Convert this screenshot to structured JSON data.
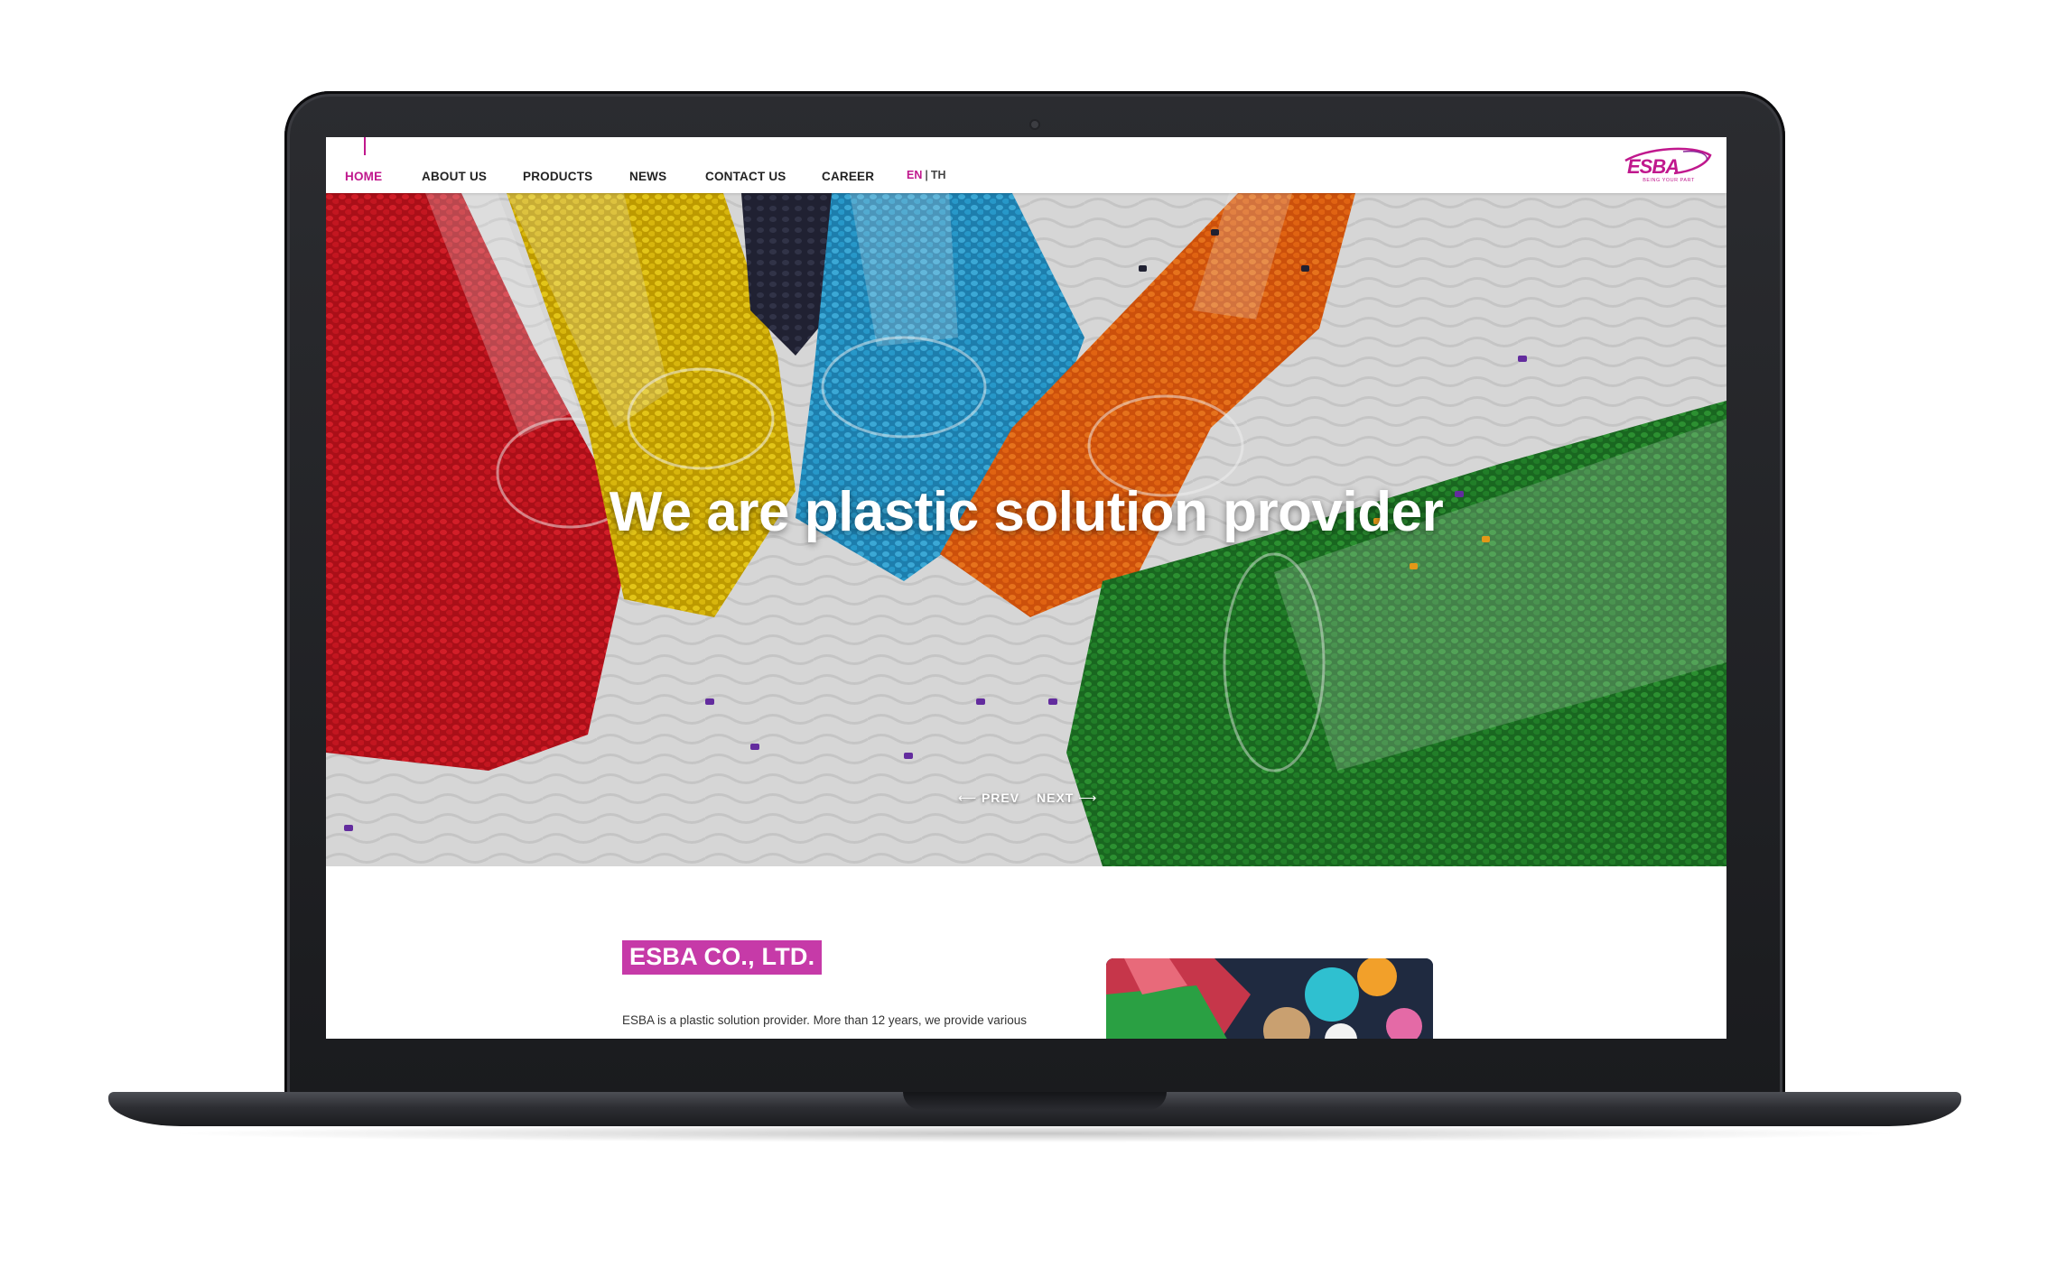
{
  "nav": {
    "items": [
      {
        "label": "HOME",
        "active": true
      },
      {
        "label": "ABOUT US",
        "active": false
      },
      {
        "label": "PRODUCTS",
        "active": false
      },
      {
        "label": "NEWS",
        "active": false
      },
      {
        "label": "CONTACT US",
        "active": false
      },
      {
        "label": "CAREER",
        "active": false
      }
    ],
    "lang_en": "EN",
    "lang_sep": "|",
    "lang_th": "TH"
  },
  "logo": {
    "text": "ESBA",
    "tagline": "BEING YOUR PART"
  },
  "hero": {
    "title": "We are plastic solution provider",
    "prev_label": "PREV",
    "next_label": "NEXT",
    "prev_icon": "arrow-left-icon",
    "next_icon": "arrow-right-icon"
  },
  "about": {
    "heading": "ESBA CO., LTD.",
    "text": "ESBA is a plastic solution provider. More than 12 years, we provide various"
  },
  "colors": {
    "accent": "#c0188d",
    "badge": "#c63aa8"
  }
}
